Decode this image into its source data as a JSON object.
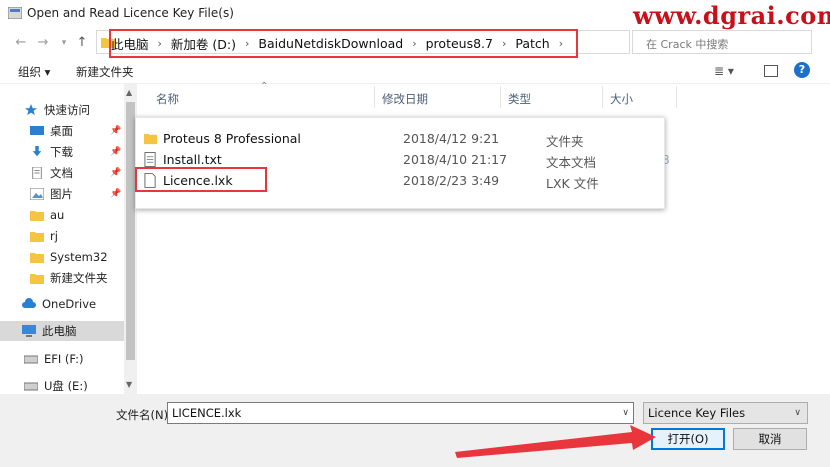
{
  "window": {
    "title": "Open and Read Licence Key File(s)"
  },
  "watermark": "www.dgrai.com",
  "nav": {
    "breadcrumbs": [
      "此电脑",
      "新加卷 (D:)",
      "BaiduNetdiskDownload",
      "proteus8.7",
      "Patch"
    ],
    "search_placeholder": "在 Crack 中搜索"
  },
  "toolbar": {
    "organize": "组织 ▾",
    "new_folder": "新建文件夹",
    "view_icon": "≣ ▾"
  },
  "sidebar": {
    "items": [
      {
        "label": "快速访问",
        "icon": "star-icon"
      },
      {
        "label": "桌面",
        "icon": "desktop-icon"
      },
      {
        "label": "下载",
        "icon": "download-icon"
      },
      {
        "label": "文档",
        "icon": "document-icon"
      },
      {
        "label": "图片",
        "icon": "picture-icon"
      },
      {
        "label": "au",
        "icon": "folder-icon"
      },
      {
        "label": "rj",
        "icon": "folder-icon"
      },
      {
        "label": "System32",
        "icon": "folder-icon"
      },
      {
        "label": "新建文件夹",
        "icon": "folder-icon"
      },
      {
        "label": "OneDrive",
        "icon": "cloud-icon"
      },
      {
        "label": "此电脑",
        "icon": "computer-icon"
      },
      {
        "label": "EFI (F:)",
        "icon": "drive-icon"
      },
      {
        "label": "U盘 (E:)",
        "icon": "drive-icon"
      }
    ]
  },
  "columns": {
    "name": "名称",
    "modified": "修改日期",
    "type": "类型",
    "size": "大小"
  },
  "files": [
    {
      "name": "Proteus 8 Professional",
      "date": "2018/4/12 9:21",
      "type": "文件夹",
      "icon": "folder-icon"
    },
    {
      "name": "Install.txt",
      "date": "2018/4/10 21:17",
      "type": "文本文档",
      "icon": "text-file-icon"
    },
    {
      "name": "Licence.lxk",
      "date": "2018/2/23 3:49",
      "type": "LXK 文件",
      "icon": "file-icon"
    }
  ],
  "ghost_text": "8",
  "bottom": {
    "filename_label": "文件名(N):",
    "filename_value": "LICENCE.lxk",
    "filetype_value": "Licence Key Files",
    "open_label": "打开(O)",
    "cancel_label": "取消"
  },
  "colors": {
    "annotation_red": "#e8363c",
    "accent_blue": "#0078d7",
    "folder_yellow": "#f5c542"
  }
}
